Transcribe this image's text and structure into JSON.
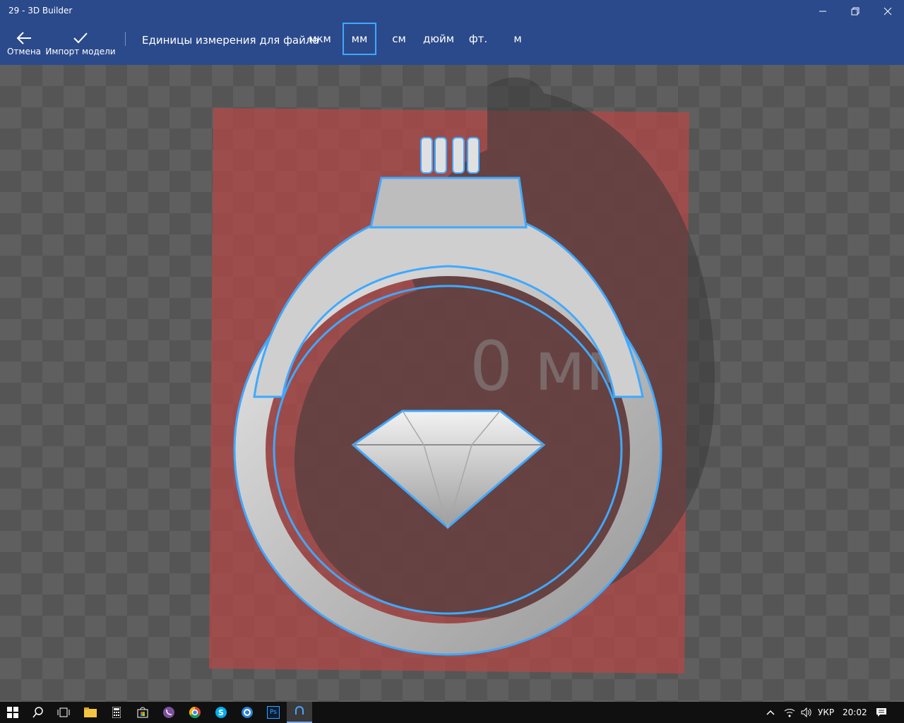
{
  "window": {
    "title": "29 - 3D Builder"
  },
  "toolbar": {
    "cancel_label": "Отмена",
    "import_label": "Импорт модели",
    "units_label": "Единицы измерения для файла",
    "units": [
      "мкм",
      "мм",
      "см",
      "дюйм",
      "фт.",
      "м"
    ],
    "selected_unit": "мм"
  },
  "viewport": {
    "dimension_watermark": "0 мм"
  },
  "taskbar": {
    "apps": [
      "windows-start",
      "search",
      "task-view",
      "file-explorer",
      "calculator",
      "store",
      "viber",
      "chrome",
      "skype",
      "app-blue-circle",
      "photoshop",
      "3d-builder"
    ],
    "photoshop_label": "Ps",
    "language": "УКР",
    "clock": "20:02"
  },
  "colors": {
    "accent": "#2b4a8b",
    "selection": "#3fa9ff",
    "bed": "#b04848"
  }
}
